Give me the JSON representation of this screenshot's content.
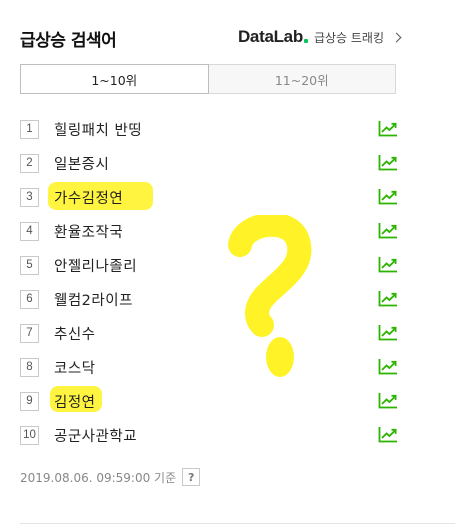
{
  "header": {
    "title": "급상승 검색어",
    "datalab_brand": "DataLab",
    "datalab_link": "급상승 트래킹"
  },
  "tabs": [
    {
      "label": "1~10위",
      "active": true
    },
    {
      "label": "11~20위",
      "active": false
    }
  ],
  "keywords": [
    {
      "rank": "1",
      "text": "힐링패치 반띵"
    },
    {
      "rank": "2",
      "text": "일본증시"
    },
    {
      "rank": "3",
      "text": "가수김정연"
    },
    {
      "rank": "4",
      "text": "환율조작국"
    },
    {
      "rank": "5",
      "text": "안젤리나졸리"
    },
    {
      "rank": "6",
      "text": "웰컴2라이프"
    },
    {
      "rank": "7",
      "text": "추신수"
    },
    {
      "rank": "8",
      "text": "코스닥"
    },
    {
      "rank": "9",
      "text": "김정연"
    },
    {
      "rank": "10",
      "text": "공군사관학교"
    }
  ],
  "footer": {
    "timestamp": "2019.08.06. 09:59:00 기준",
    "help": "?"
  },
  "colors": {
    "trend_icon": "#2db400",
    "highlight": "#fff000",
    "brand_dot": "#03c75a"
  },
  "icons": {
    "trend": "trend-chart-icon",
    "datalab_arrow": "chevron-right-icon",
    "help": "help-icon"
  }
}
